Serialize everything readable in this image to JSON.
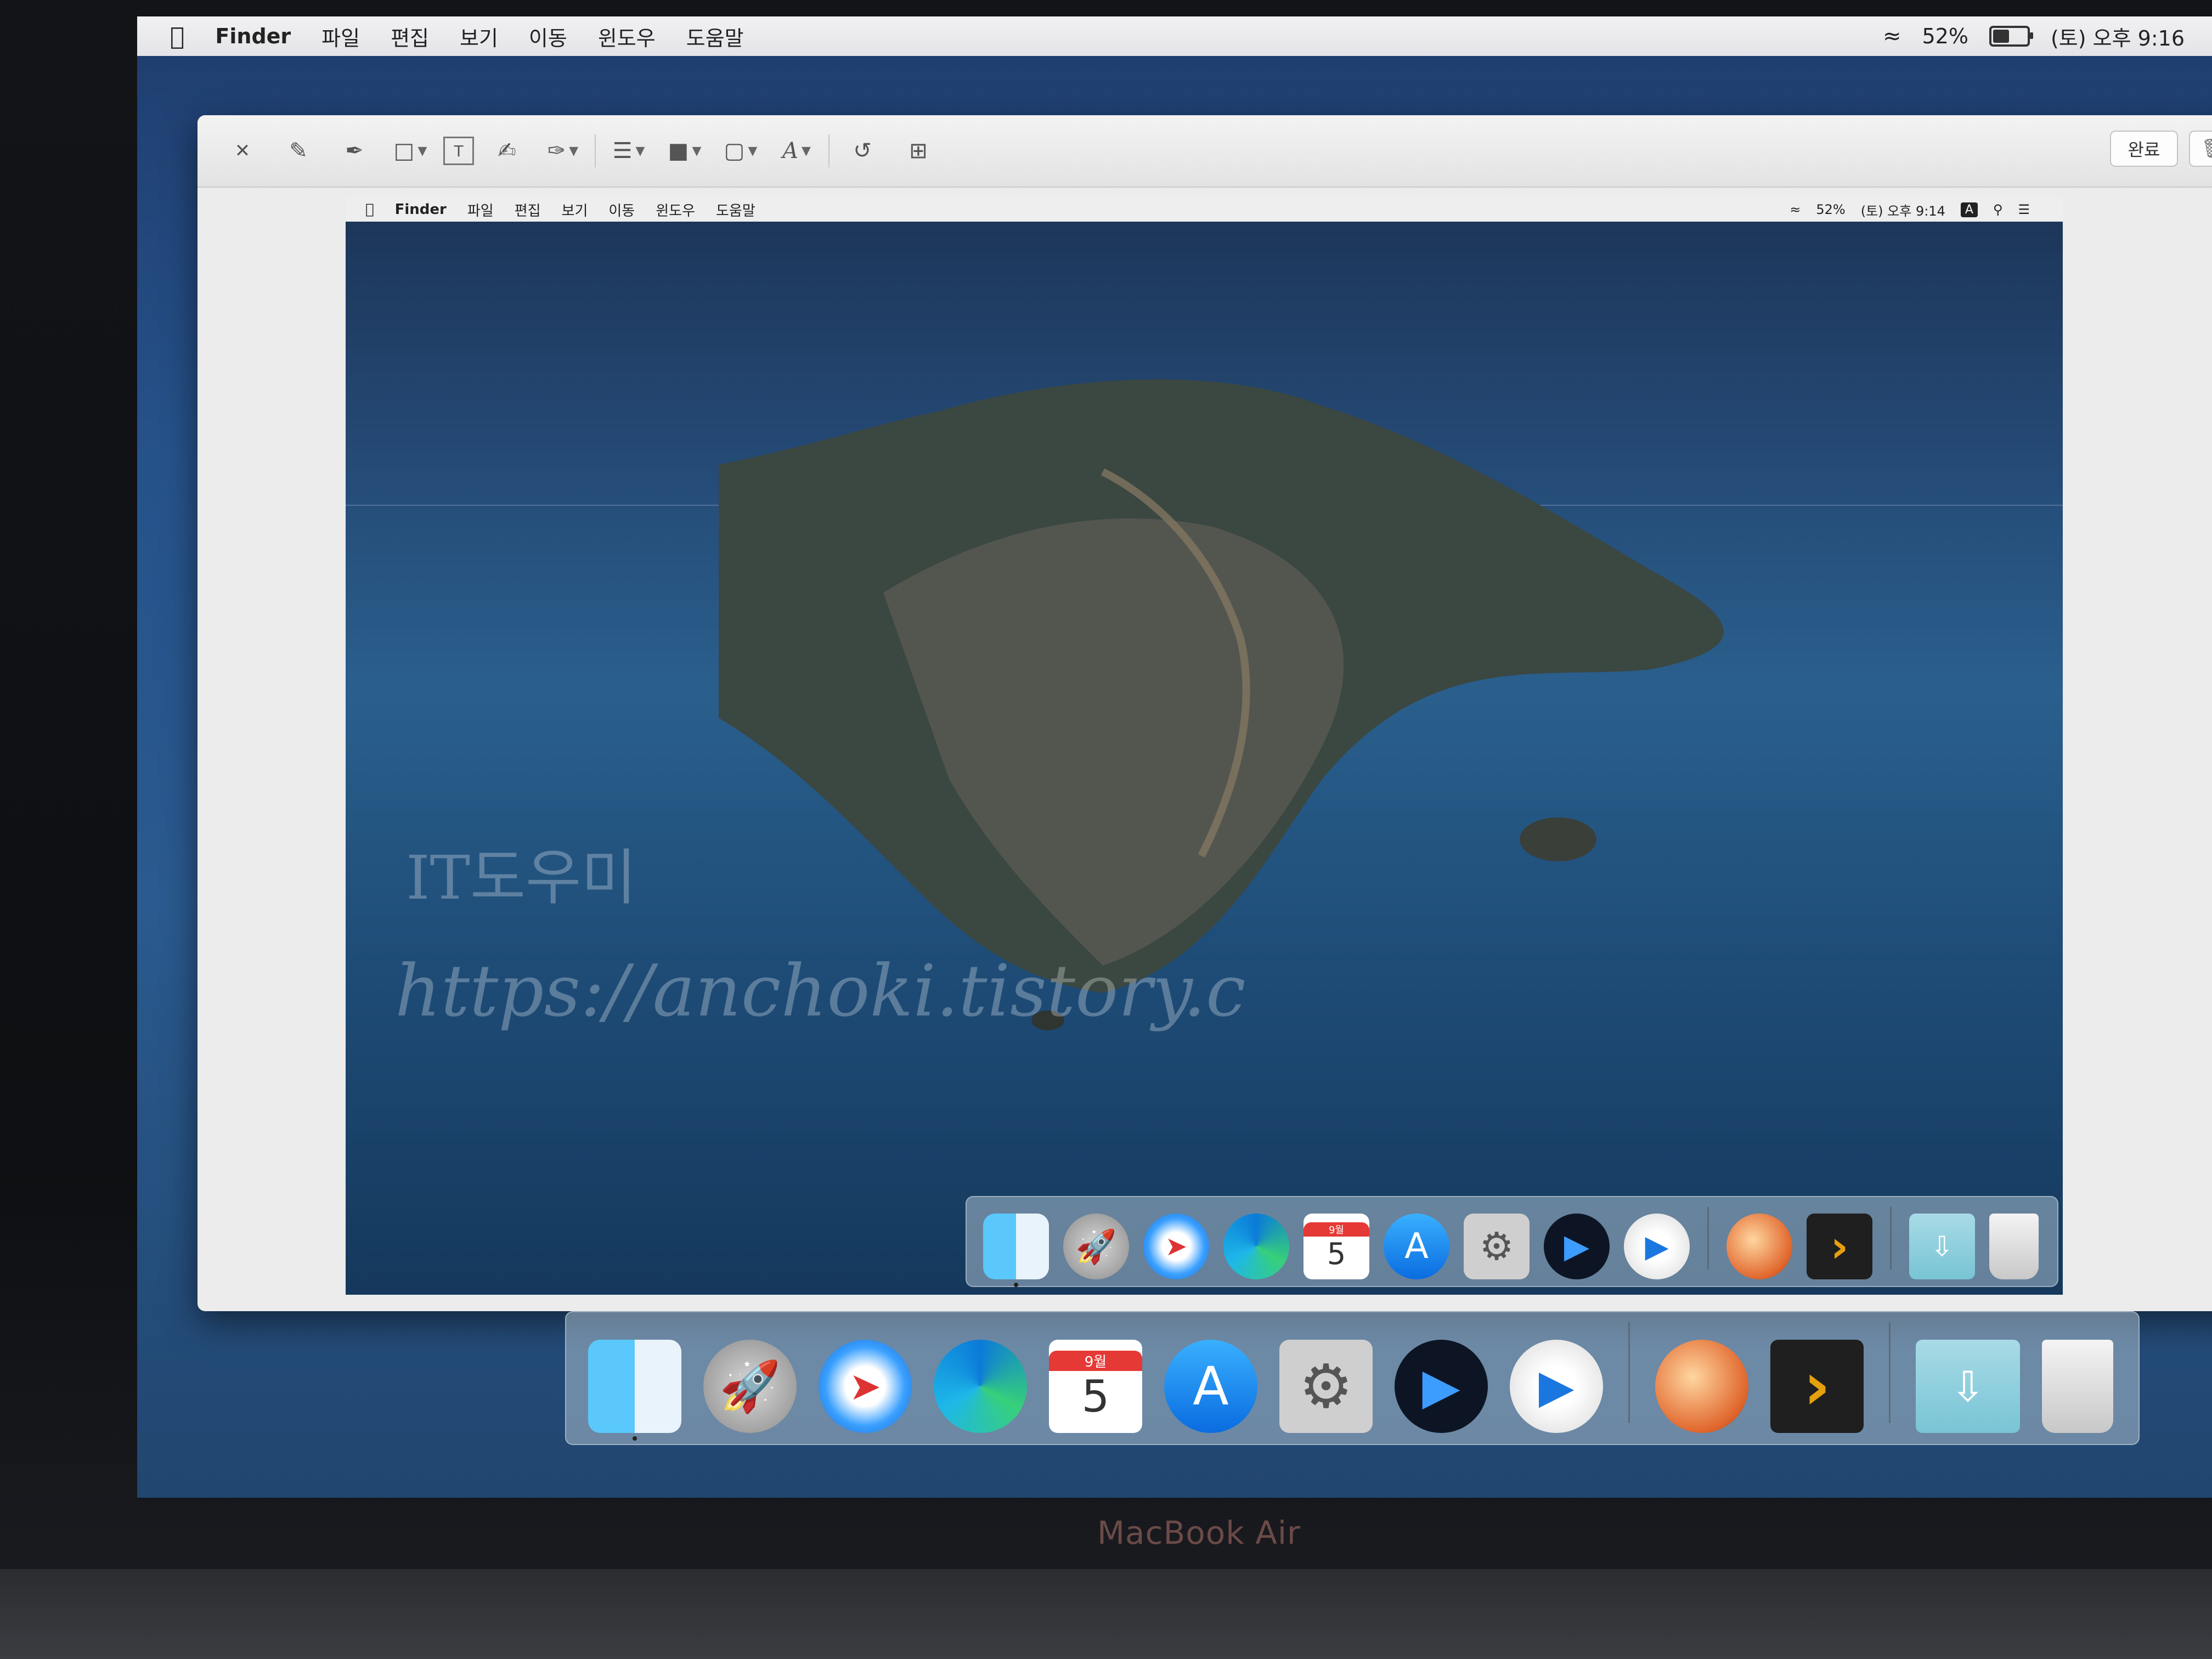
{
  "menubar": {
    "app_name": "Finder",
    "items": [
      "파일",
      "편집",
      "보기",
      "이동",
      "윈도우",
      "도움말"
    ],
    "battery_percent": "52%",
    "datetime": "(토) 오후 9:16",
    "battery_level": 0.52
  },
  "markup_window": {
    "done_label": "완료",
    "tools": [
      "close-icon",
      "sketch-icon",
      "draw-icon",
      "shapes-icon",
      "text-icon",
      "highlight-icon",
      "sign-icon",
      "shape-style-icon",
      "border-color-icon",
      "fill-color-icon",
      "text-style-icon",
      "rotate-icon",
      "crop-icon"
    ]
  },
  "inner_screenshot": {
    "menubar": {
      "app_name": "Finder",
      "items": [
        "파일",
        "편집",
        "보기",
        "이동",
        "윈도우",
        "도움말"
      ],
      "battery_percent": "52%",
      "datetime": "(토) 오후 9:14",
      "input_badge": "A"
    },
    "watermark_line1": "IT도우미",
    "watermark_line2": "https://anchoki.tistory.c"
  },
  "dock": {
    "calendar_month": "9월",
    "calendar_day": "5",
    "apps": [
      "Finder",
      "Launchpad",
      "Safari",
      "Microsoft Edge",
      "Calendar",
      "App Store",
      "System Preferences",
      "Media Player",
      "QuickTime Player",
      "Basketball",
      "Plex",
      "Downloads",
      "Trash"
    ]
  },
  "device_brand": "MacBook Air"
}
